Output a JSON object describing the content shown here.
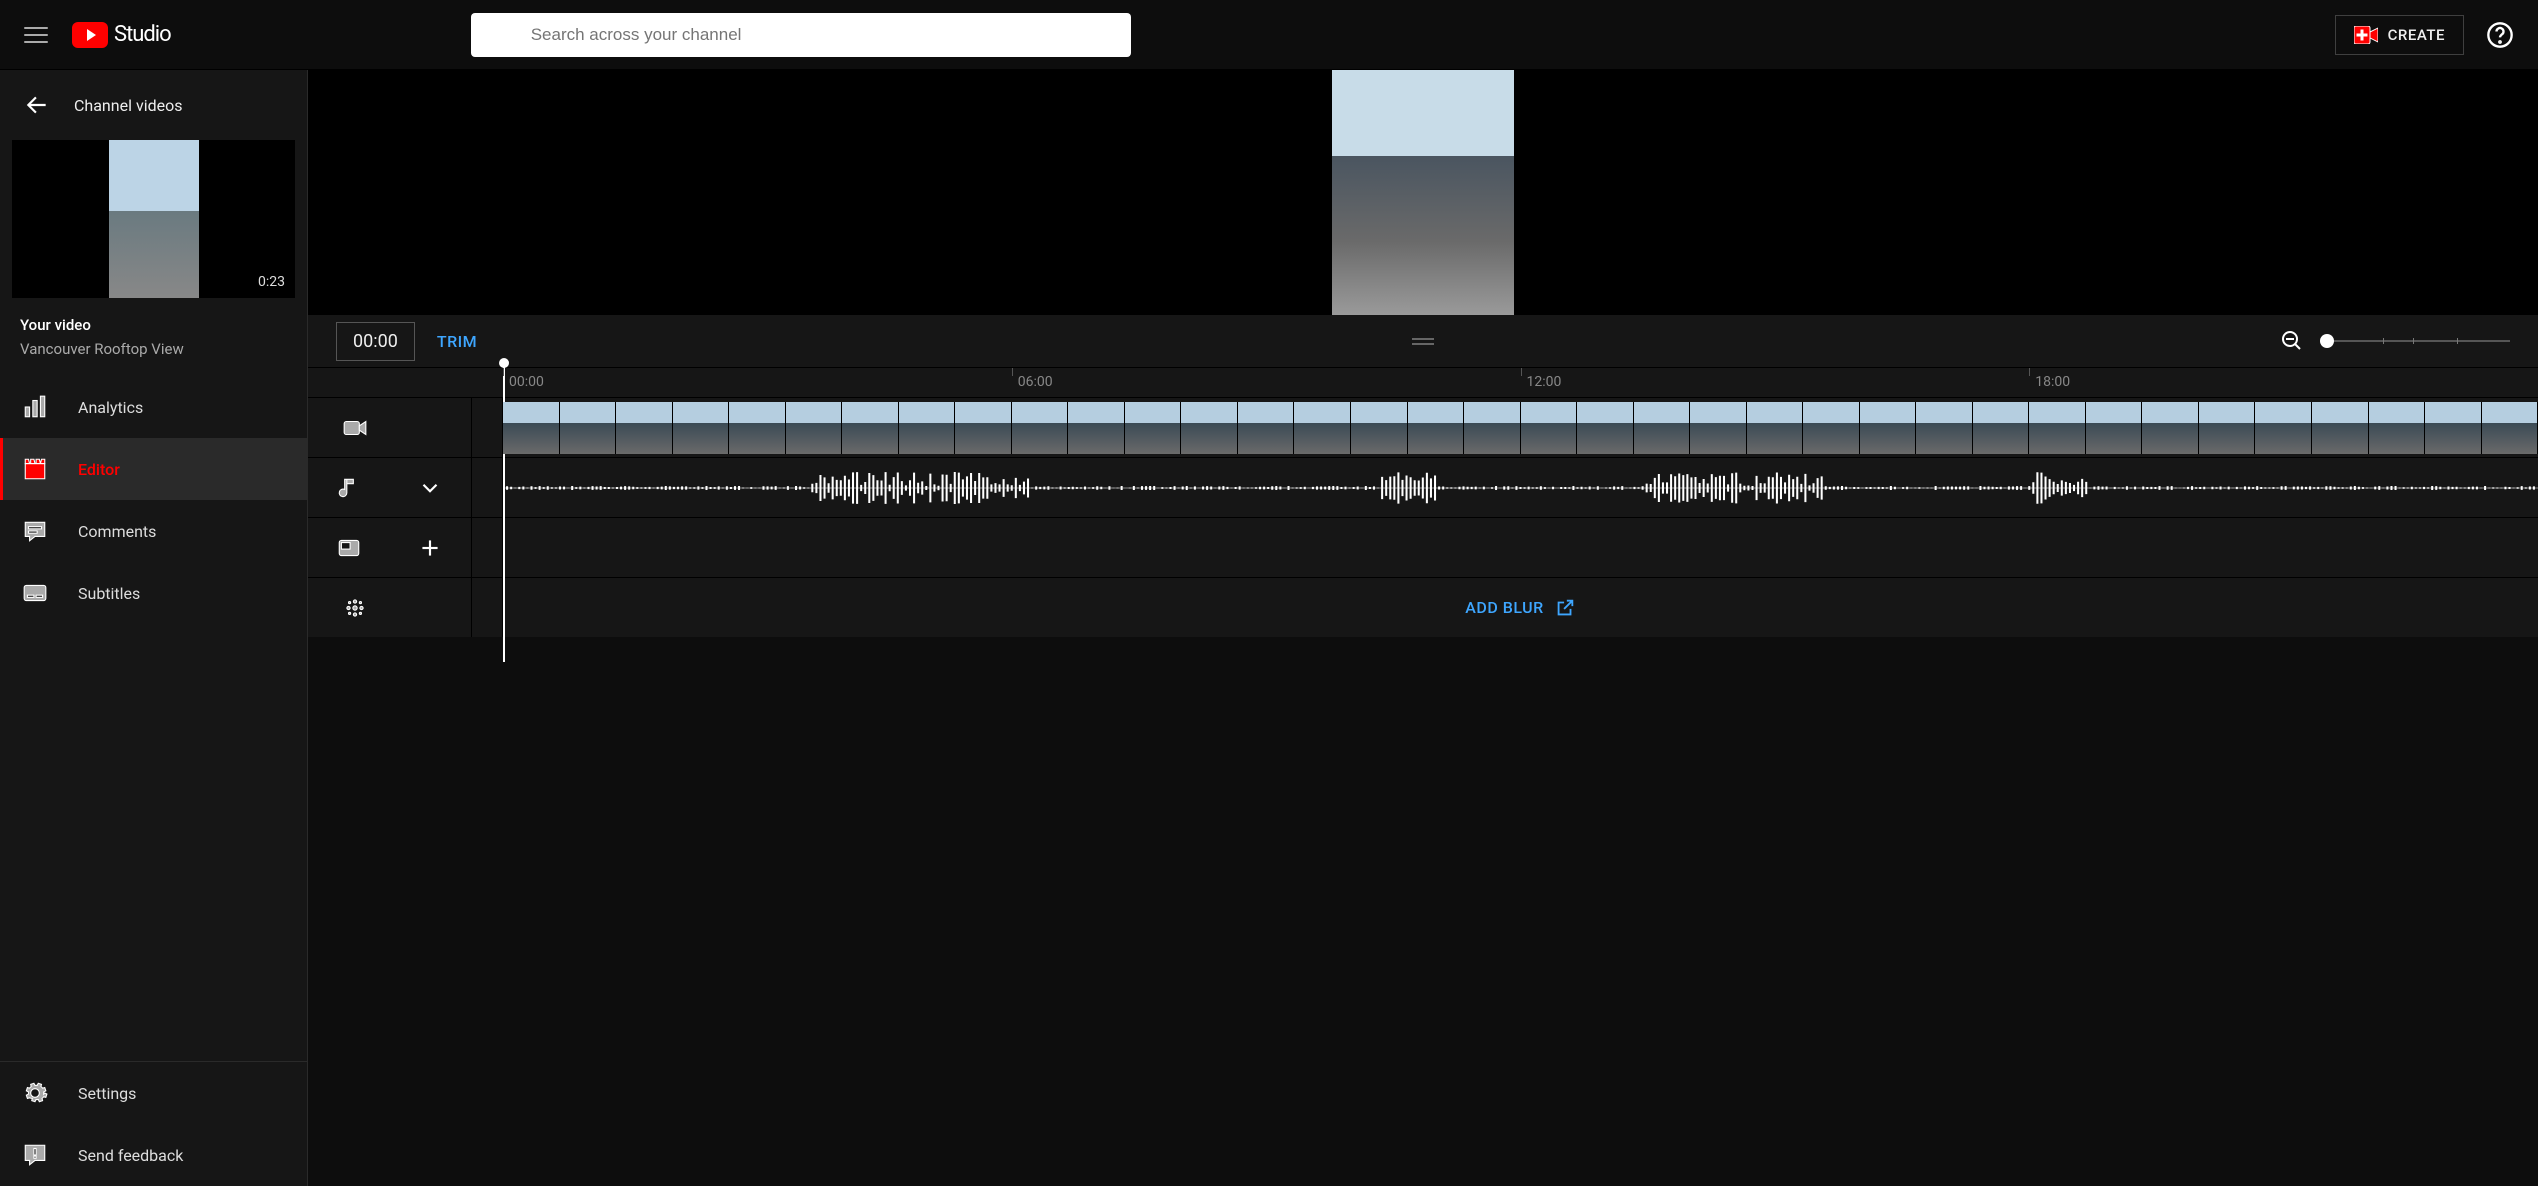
{
  "header": {
    "logo_text": "Studio",
    "search_placeholder": "Search across your channel",
    "create_label": "CREATE"
  },
  "sidebar": {
    "back_label": "Channel videos",
    "thumb_duration": "0:23",
    "video_label": "Your video",
    "video_title": "Vancouver Rooftop View",
    "nav": {
      "analytics": "Analytics",
      "editor": "Editor",
      "comments": "Comments",
      "subtitles": "Subtitles",
      "settings": "Settings",
      "feedback": "Send feedback"
    }
  },
  "editor": {
    "current_time": "00:00",
    "trim_label": "TRIM",
    "ruler": [
      "00:00",
      "06:00",
      "12:00",
      "18:00"
    ],
    "add_blur_label": "ADD BLUR"
  }
}
